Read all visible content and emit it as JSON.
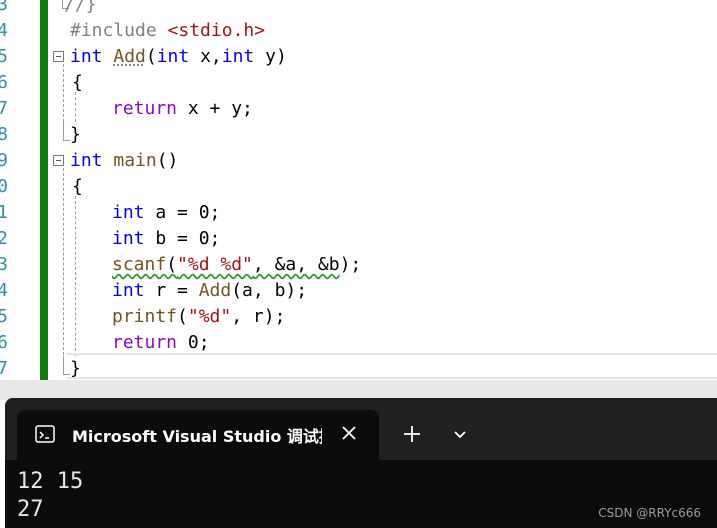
{
  "editor": {
    "line_numbers": [
      "3",
      "4",
      "5",
      "6",
      "7",
      "8",
      "9",
      "0",
      "1",
      "2",
      "3",
      "4",
      "5",
      "6",
      "7"
    ],
    "top_comment": "//}",
    "include": {
      "directive": "#include ",
      "header": "<stdio.h>"
    },
    "add_sig": {
      "ret": "int",
      "name": "Add",
      "open": "(",
      "t1": "int",
      "p1": " x,",
      "t2": "int",
      "p2": " y",
      "close": ")"
    },
    "brace_open_1": "{",
    "return_add": {
      "kw": "return",
      "expr": " x + y;"
    },
    "brace_close_1": "}",
    "main_sig": {
      "ret": "int",
      "name": "main",
      "parens": "()"
    },
    "brace_open_2": "{",
    "decl_a": {
      "type": "int",
      "rest": " a = 0;"
    },
    "decl_b": {
      "type": "int",
      "rest": " b = 0;"
    },
    "scanf_line": {
      "fn": "scanf",
      "open": "(",
      "fmt": "\"%d %d\"",
      "args": ", &a, &b",
      "close": ");"
    },
    "decl_r": {
      "type": "int",
      "var": " r = ",
      "fn": "Add",
      "args": "(a, b);"
    },
    "printf_line": {
      "fn": "printf",
      "open": "(",
      "fmt": "\"%d\"",
      "args": ", r);"
    },
    "return_main": {
      "kw": "return",
      "rest": " 0;"
    },
    "brace_close_2": "}"
  },
  "terminal": {
    "tab_title": "Microsoft Visual Studio 调试控制台",
    "output_lines": [
      "12 15",
      "27"
    ]
  },
  "icons": {
    "tab": "console-icon",
    "close": "close-icon",
    "new_tab": "plus-icon",
    "dropdown": "chevron-down-icon"
  },
  "watermark": "CSDN @RRYc666",
  "colors": {
    "keyword": "#0000ff",
    "control": "#8f08c4",
    "function": "#74531f",
    "string": "#a31515",
    "line_number": "#2b91af",
    "change_bar": "#107c10",
    "terminal_bg": "#0c0c0c"
  }
}
